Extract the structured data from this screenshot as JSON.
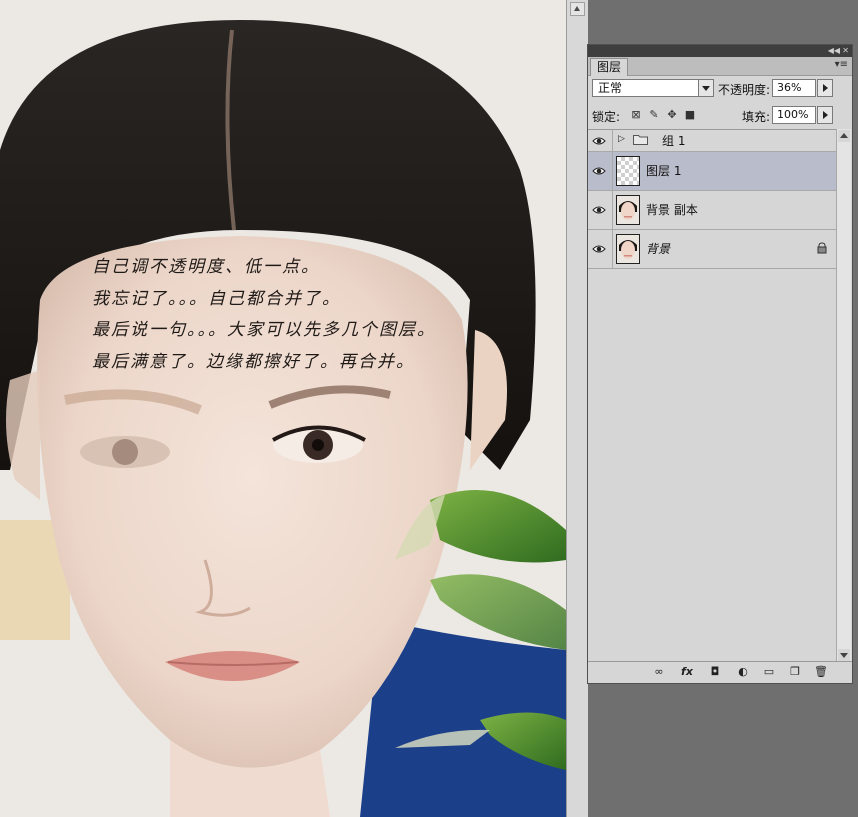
{
  "canvas": {
    "note_lines": [
      "自己调不透明度、低一点。",
      "我忘记了。。。自己都合并了。",
      "最后说一句。。。大家可以先多几个图层。",
      "最后满意了。边缘都擦好了。再合并。"
    ]
  },
  "layers_panel": {
    "tab_label": "图层",
    "blend_mode": "正常",
    "opacity_label": "不透明度:",
    "opacity_value": "36%",
    "lock_label": "锁定:",
    "fill_label": "填充:",
    "fill_value": "100%",
    "layers": [
      {
        "name": "组 1",
        "type": "group",
        "visible": true,
        "expanded": false
      },
      {
        "name": "图层 1",
        "type": "layer",
        "visible": true,
        "selected": true,
        "thumbnail": "transparent"
      },
      {
        "name": "背景 副本",
        "type": "layer",
        "visible": true,
        "thumbnail": "face"
      },
      {
        "name": "背景",
        "type": "background",
        "visible": true,
        "locked": true,
        "thumbnail": "face"
      }
    ],
    "bottom_icons": [
      "link-icon",
      "fx-icon",
      "mask-icon",
      "adjustment-icon",
      "folder-icon",
      "new-layer-icon",
      "trash-icon"
    ],
    "fx_label": "fx"
  },
  "colors": {
    "selected_row": "#b9bccb",
    "panel_bg": "#d6d6d6",
    "app_bg": "#6f6f6f"
  }
}
